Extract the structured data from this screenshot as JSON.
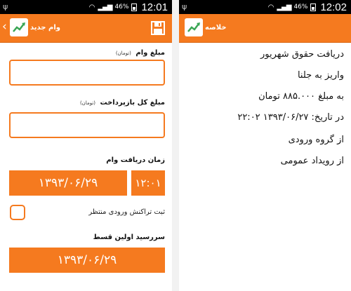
{
  "status_bar_left": {
    "battery": "46%",
    "time": "12:01"
  },
  "status_bar_right": {
    "battery": "46%",
    "time": "12:02"
  },
  "new_loan_screen": {
    "title": "وام جدید",
    "loan_amount": {
      "label": "مبلغ وام",
      "unit": "(تومان)",
      "value": ""
    },
    "total_repayment": {
      "label": "مبلغ کل بازپرداخت",
      "unit": "(تومان)",
      "value": ""
    },
    "receive_time": {
      "label": "زمان دریافت وام",
      "date": "۱۳۹۳/۰۶/۲۹",
      "time": "۱۲:۰۱"
    },
    "pending_checkbox": {
      "label": "ثبت تراکنش ورودی منتظر",
      "checked": false
    },
    "first_installment": {
      "label": "سررسید اولین قسط",
      "date": "۱۳۹۳/۰۶/۲۹"
    }
  },
  "summary_screen": {
    "title": "خلاصه",
    "lines": [
      "دریافت حقوق شهریور",
      "واریز به جلنا",
      "به مبلغ ۸۸۵.۰۰۰ تومان",
      "در تاریخ: ۱۳۹۳/۰۶/۲۷ ۲۲:۰۲",
      "از گروه ورودی",
      "از رویداد عمومی"
    ]
  },
  "colors": {
    "accent": "#f57a1f",
    "status_bar": "#000000",
    "background": "#ffffff"
  },
  "icons": [
    "usb-icon",
    "wifi-icon",
    "signal-icon",
    "battery-icon",
    "back-chevron-icon",
    "app-chart-icon",
    "save-icon"
  ]
}
